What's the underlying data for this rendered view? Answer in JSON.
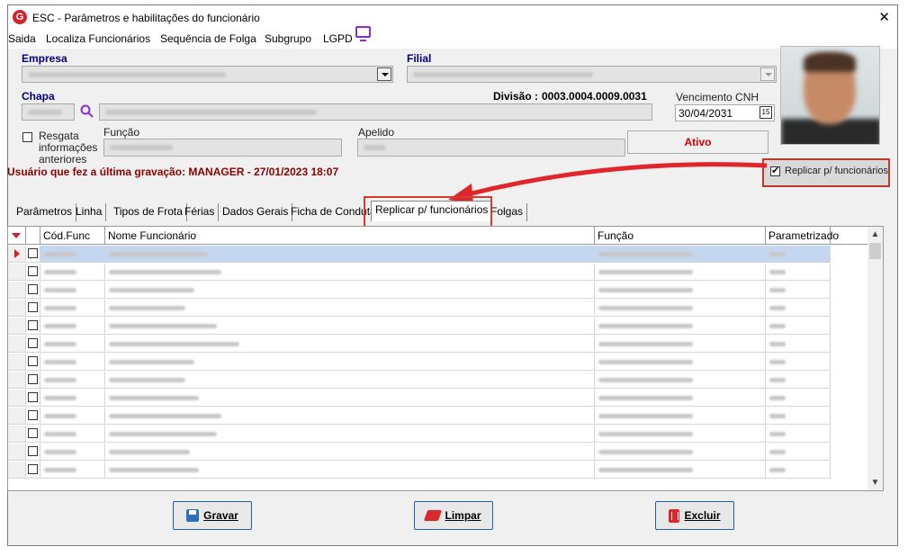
{
  "window": {
    "title": "ESC - Parâmetros e habilitações do funcionário",
    "close_glyph": "✕"
  },
  "menu": [
    "Saida",
    "Localiza Funcionários",
    "Sequência de Folga",
    "Subgrupo",
    "LGPD"
  ],
  "form": {
    "empresa_label": "Empresa",
    "filial_label": "Filial",
    "chapa_label": "Chapa",
    "divisao_label": "Divisão :",
    "divisao_value": "0003.0004.0009.0031",
    "vencimento_cnh_label": "Vencimento  CNH",
    "vencimento_cnh_value": "30/04/2031",
    "calendar_glyph": "15",
    "resgata_label": "Resgata informações anteriores",
    "funcao_label": "Função",
    "apelido_label": "Apelido",
    "status": "Ativo",
    "last_save_text": "Usuário que fez a última gravação: MANAGER - 27/01/2023 18:07",
    "replicar_checkbox_label": "Replicar p/ funcionários"
  },
  "tabs": [
    "Parâmetros",
    "Linha",
    "Tipos de Frota",
    "Férias",
    "Dados Gerais",
    "Ficha de Conduta",
    "Replicar p/ funcionários",
    "Folgas"
  ],
  "active_tab": 6,
  "grid": {
    "columns": [
      "Cód.Func",
      "Nome Funcionário",
      "Função",
      "Parametrizado"
    ],
    "row_count": 13
  },
  "buttons": {
    "save": "Gravar",
    "clear": "Limpar",
    "delete": "Excluir"
  },
  "colors": {
    "accent_arrow": "#e0262b",
    "status_text": "#d00000",
    "label_blue": "#000080",
    "last_save_red": "#8b0000"
  }
}
